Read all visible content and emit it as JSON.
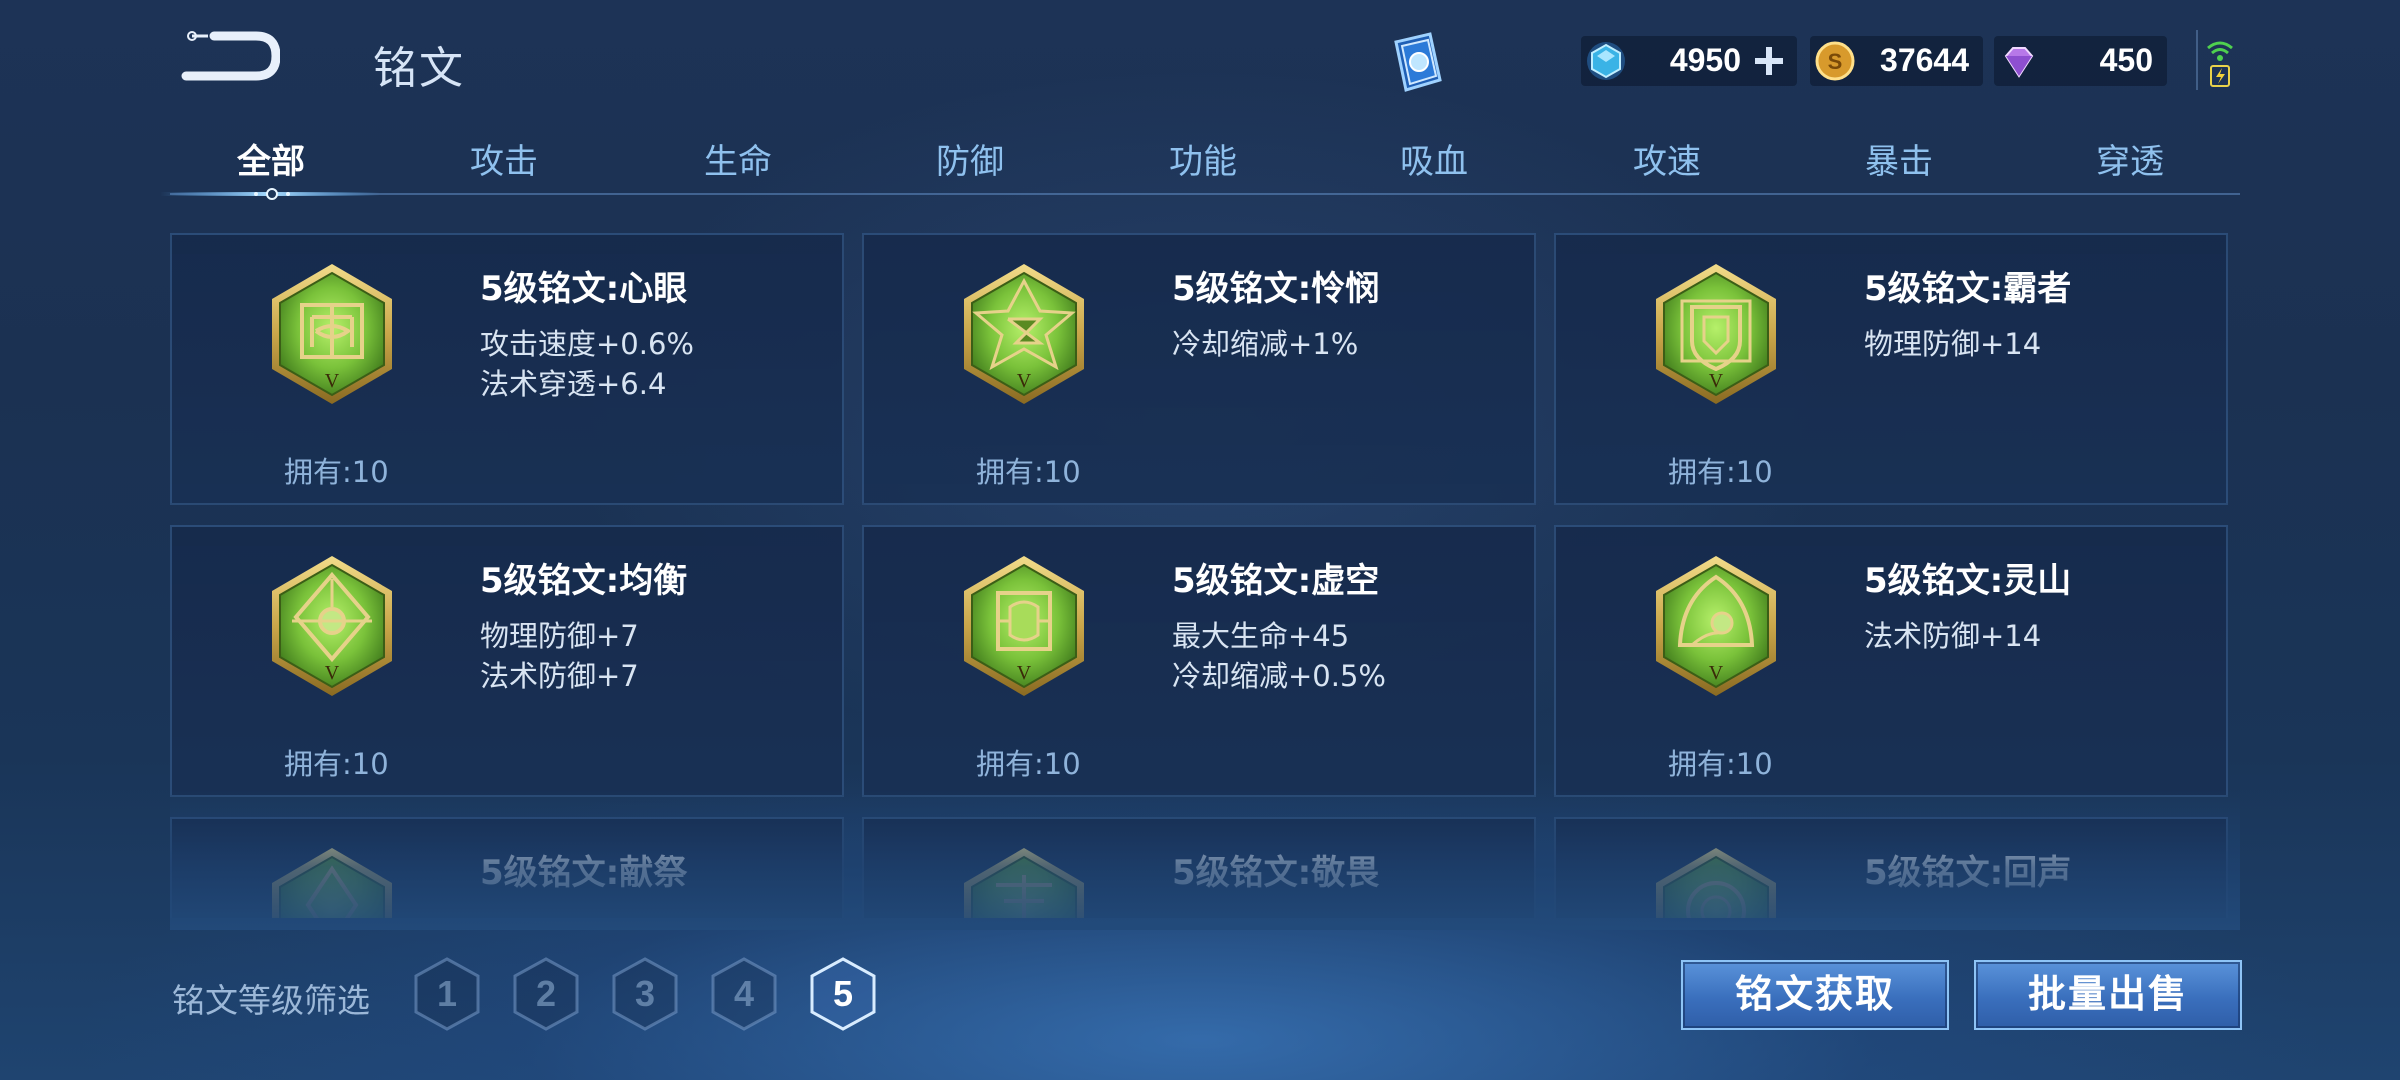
{
  "header": {
    "title": "铭文",
    "currencies": [
      {
        "name": "diamond",
        "value": "4950",
        "icon": "blue-crystal-icon",
        "has_plus": true
      },
      {
        "name": "gold",
        "value": "37644",
        "icon": "gold-coin-icon",
        "has_plus": false
      },
      {
        "name": "gem",
        "value": "450",
        "icon": "purple-gem-icon",
        "has_plus": false
      }
    ]
  },
  "tabs": [
    {
      "label": "全部",
      "active": true
    },
    {
      "label": "攻击",
      "active": false
    },
    {
      "label": "生命",
      "active": false
    },
    {
      "label": "防御",
      "active": false
    },
    {
      "label": "功能",
      "active": false
    },
    {
      "label": "吸血",
      "active": false
    },
    {
      "label": "攻速",
      "active": false
    },
    {
      "label": "暴击",
      "active": false
    },
    {
      "label": "穿透",
      "active": false
    }
  ],
  "cards": [
    {
      "name": "5级铭文:心眼",
      "stats": [
        "攻击速度+0.6%",
        "法术穿透+6.4"
      ],
      "owned": "拥有:10",
      "level_mark": "V",
      "emblem": "eye-emblem-icon"
    },
    {
      "name": "5级铭文:怜悯",
      "stats": [
        "冷却缩减+1%"
      ],
      "owned": "拥有:10",
      "level_mark": "V",
      "emblem": "hourglass-star-emblem-icon"
    },
    {
      "name": "5级铭文:霸者",
      "stats": [
        "物理防御+14"
      ],
      "owned": "拥有:10",
      "level_mark": "V",
      "emblem": "shield-emblem-icon"
    },
    {
      "name": "5级铭文:均衡",
      "stats": [
        "物理防御+7",
        "法术防御+7"
      ],
      "owned": "拥有:10",
      "level_mark": "V",
      "emblem": "balance-emblem-icon"
    },
    {
      "name": "5级铭文:虚空",
      "stats": [
        "最大生命+45",
        "冷却缩减+0.5%"
      ],
      "owned": "拥有:10",
      "level_mark": "V",
      "emblem": "void-emblem-icon"
    },
    {
      "name": "5级铭文:灵山",
      "stats": [
        "法术防御+14"
      ],
      "owned": "拥有:10",
      "level_mark": "V",
      "emblem": "mountain-emblem-icon"
    },
    {
      "name": "5级铭文:献祭",
      "stats": [],
      "owned": "",
      "level_mark": "",
      "emblem": "sacrifice-emblem-icon"
    },
    {
      "name": "5级铭文:敬畏",
      "stats": [],
      "owned": "",
      "level_mark": "",
      "emblem": "awe-emblem-icon"
    },
    {
      "name": "5级铭文:回声",
      "stats": [],
      "owned": "",
      "level_mark": "",
      "emblem": "echo-emblem-icon"
    }
  ],
  "filter": {
    "label": "铭文等级筛选",
    "levels": [
      "1",
      "2",
      "3",
      "4",
      "5"
    ],
    "selected": "5"
  },
  "buttons": {
    "get": "铭文获取",
    "sell": "批量出售"
  },
  "colors": {
    "emblem_green": "#7ac23a",
    "emblem_gold": "#c9a64a",
    "tab_text": "#8fc1ee",
    "button_blue": "#3a6fbd"
  }
}
